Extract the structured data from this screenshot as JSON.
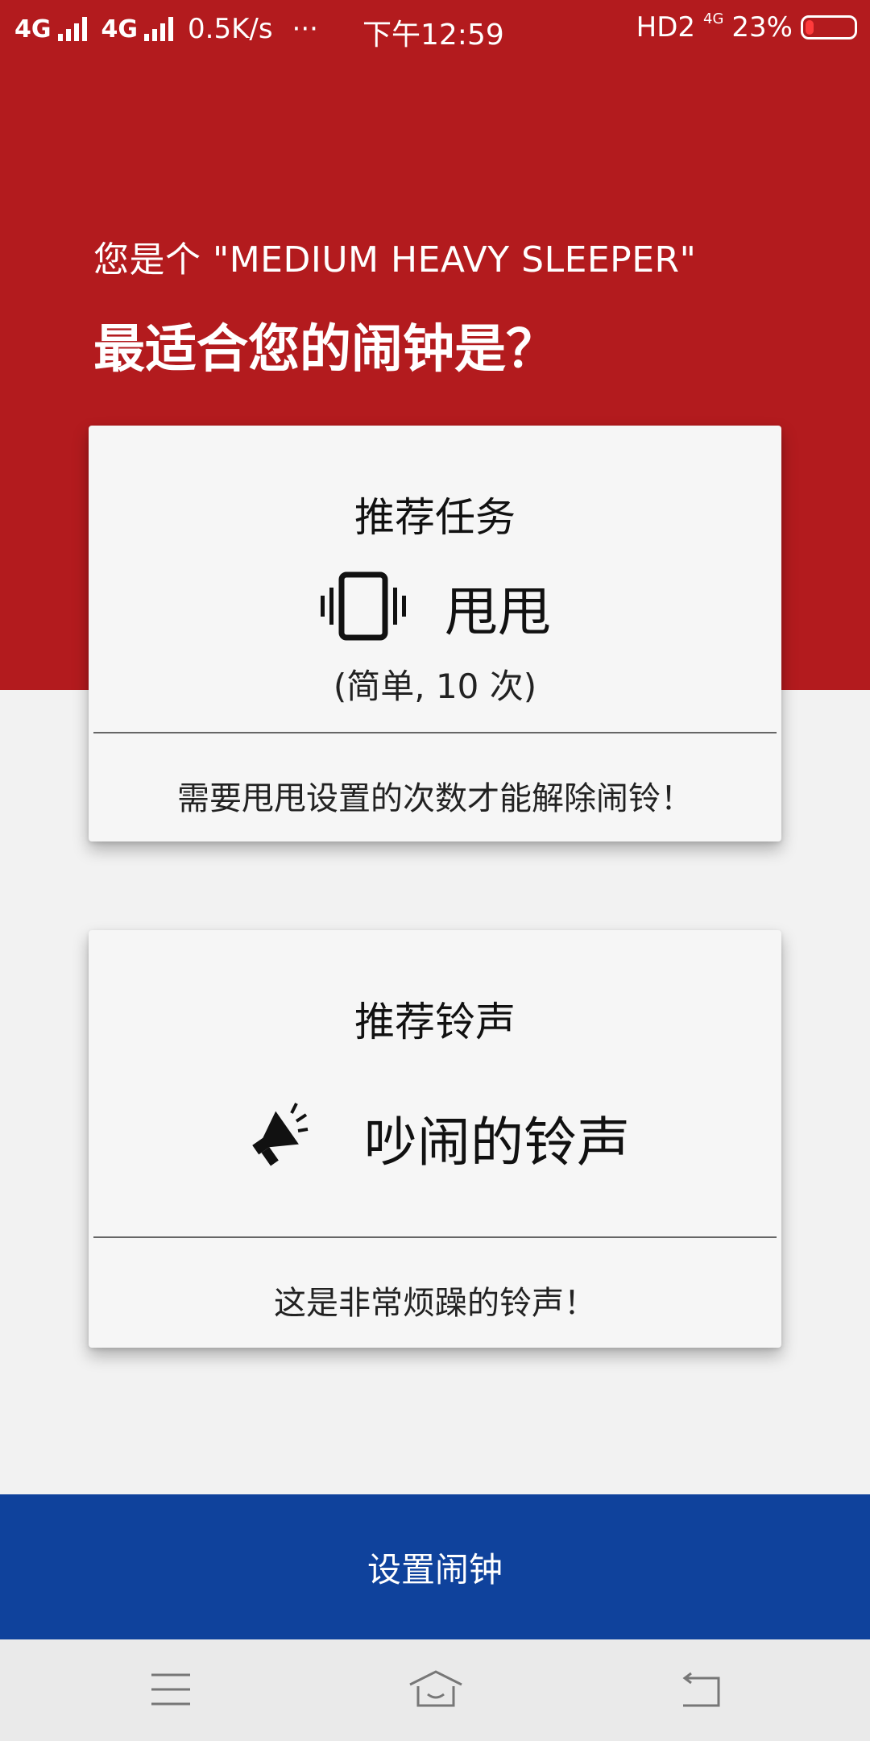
{
  "status_bar": {
    "net1": "4G",
    "net2": "4G",
    "speed": "0.5K/s",
    "more": "···",
    "time": "下午12:59",
    "hd": "HD2",
    "net_small": "4G",
    "battery": "23%"
  },
  "header": {
    "subtitle": "您是个 \"MEDIUM HEAVY SLEEPER\"",
    "title": "最适合您的闹钟是？"
  },
  "mission_card": {
    "heading": "推荐任务",
    "icon": "vibrate-phone-icon",
    "name": "甩甩",
    "detail": "(简单, 10 次)",
    "description": "需要甩甩设置的次数才能解除闹铃！"
  },
  "ringtone_card": {
    "heading": "推荐铃声",
    "icon": "megaphone-icon",
    "name": "吵闹的铃声",
    "description": "这是非常烦躁的铃声！"
  },
  "action": {
    "set_alarm_label": "设置闹钟"
  },
  "nav": {
    "menu_icon": "menu-icon",
    "home_icon": "home-icon",
    "back_icon": "back-icon"
  },
  "colors": {
    "header_red": "#b31b1e",
    "button_blue": "#0f429c",
    "background": "#f2f2f2",
    "card": "#f6f6f6"
  }
}
